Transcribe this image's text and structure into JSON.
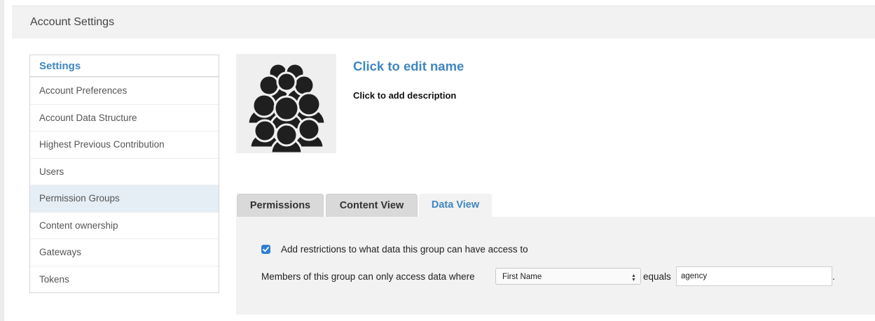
{
  "header": {
    "title": "Account Settings"
  },
  "sidebar": {
    "heading": "Settings",
    "items": [
      {
        "label": "Account Preferences"
      },
      {
        "label": "Account Data Structure"
      },
      {
        "label": "Highest Previous Contribution"
      },
      {
        "label": "Users"
      },
      {
        "label": "Permission Groups",
        "active": true
      },
      {
        "label": "Content ownership"
      },
      {
        "label": "Gateways"
      },
      {
        "label": "Tokens"
      }
    ]
  },
  "group": {
    "avatar_icon": "people-group-icon",
    "name": "Click to edit name",
    "description": "Click to add description"
  },
  "tabs": [
    {
      "label": "Permissions"
    },
    {
      "label": "Content View"
    },
    {
      "label": "Data View",
      "active": true
    }
  ],
  "data_view": {
    "restrict_checked": true,
    "restrict_label": "Add restrictions to what data this group can have access to",
    "members_label": "Members of this group can only access data where",
    "field_select_value": "First Name",
    "operator_label": "equals",
    "value_input": "agency",
    "trailing_text": "."
  },
  "colors": {
    "accent": "#3f86c1",
    "checkbox": "#2d7fd6",
    "active_item_bg": "#e5eef5"
  }
}
